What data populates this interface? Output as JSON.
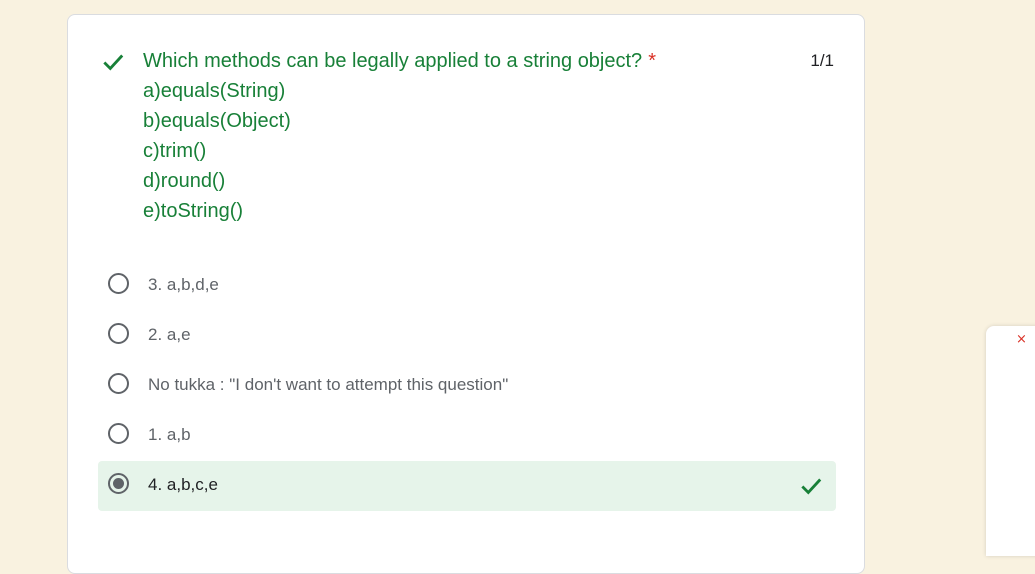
{
  "question": {
    "lines": [
      "Which methods can be legally applied to a string object?",
      "a)equals(String)",
      "b)equals(Object)",
      "c)trim()",
      "d)round()",
      "e)toString()"
    ],
    "required_marker": "*",
    "score": "1/1",
    "status_icon": "check-icon"
  },
  "options": [
    {
      "label": "3. a,b,d,e",
      "selected": false
    },
    {
      "label": "2. a,e",
      "selected": false
    },
    {
      "label": "No tukka : \"I don't want to attempt this question\"",
      "selected": false
    },
    {
      "label": "1. a,b",
      "selected": false
    },
    {
      "label": "4. a,b,c,e",
      "selected": true,
      "correct": true
    }
  ],
  "side_panel": {
    "close_symbol": "×"
  },
  "colors": {
    "correct": "#188038",
    "correct_bg": "#e6f4ea",
    "required": "#d93025",
    "page_bg": "#f9f2e0"
  }
}
